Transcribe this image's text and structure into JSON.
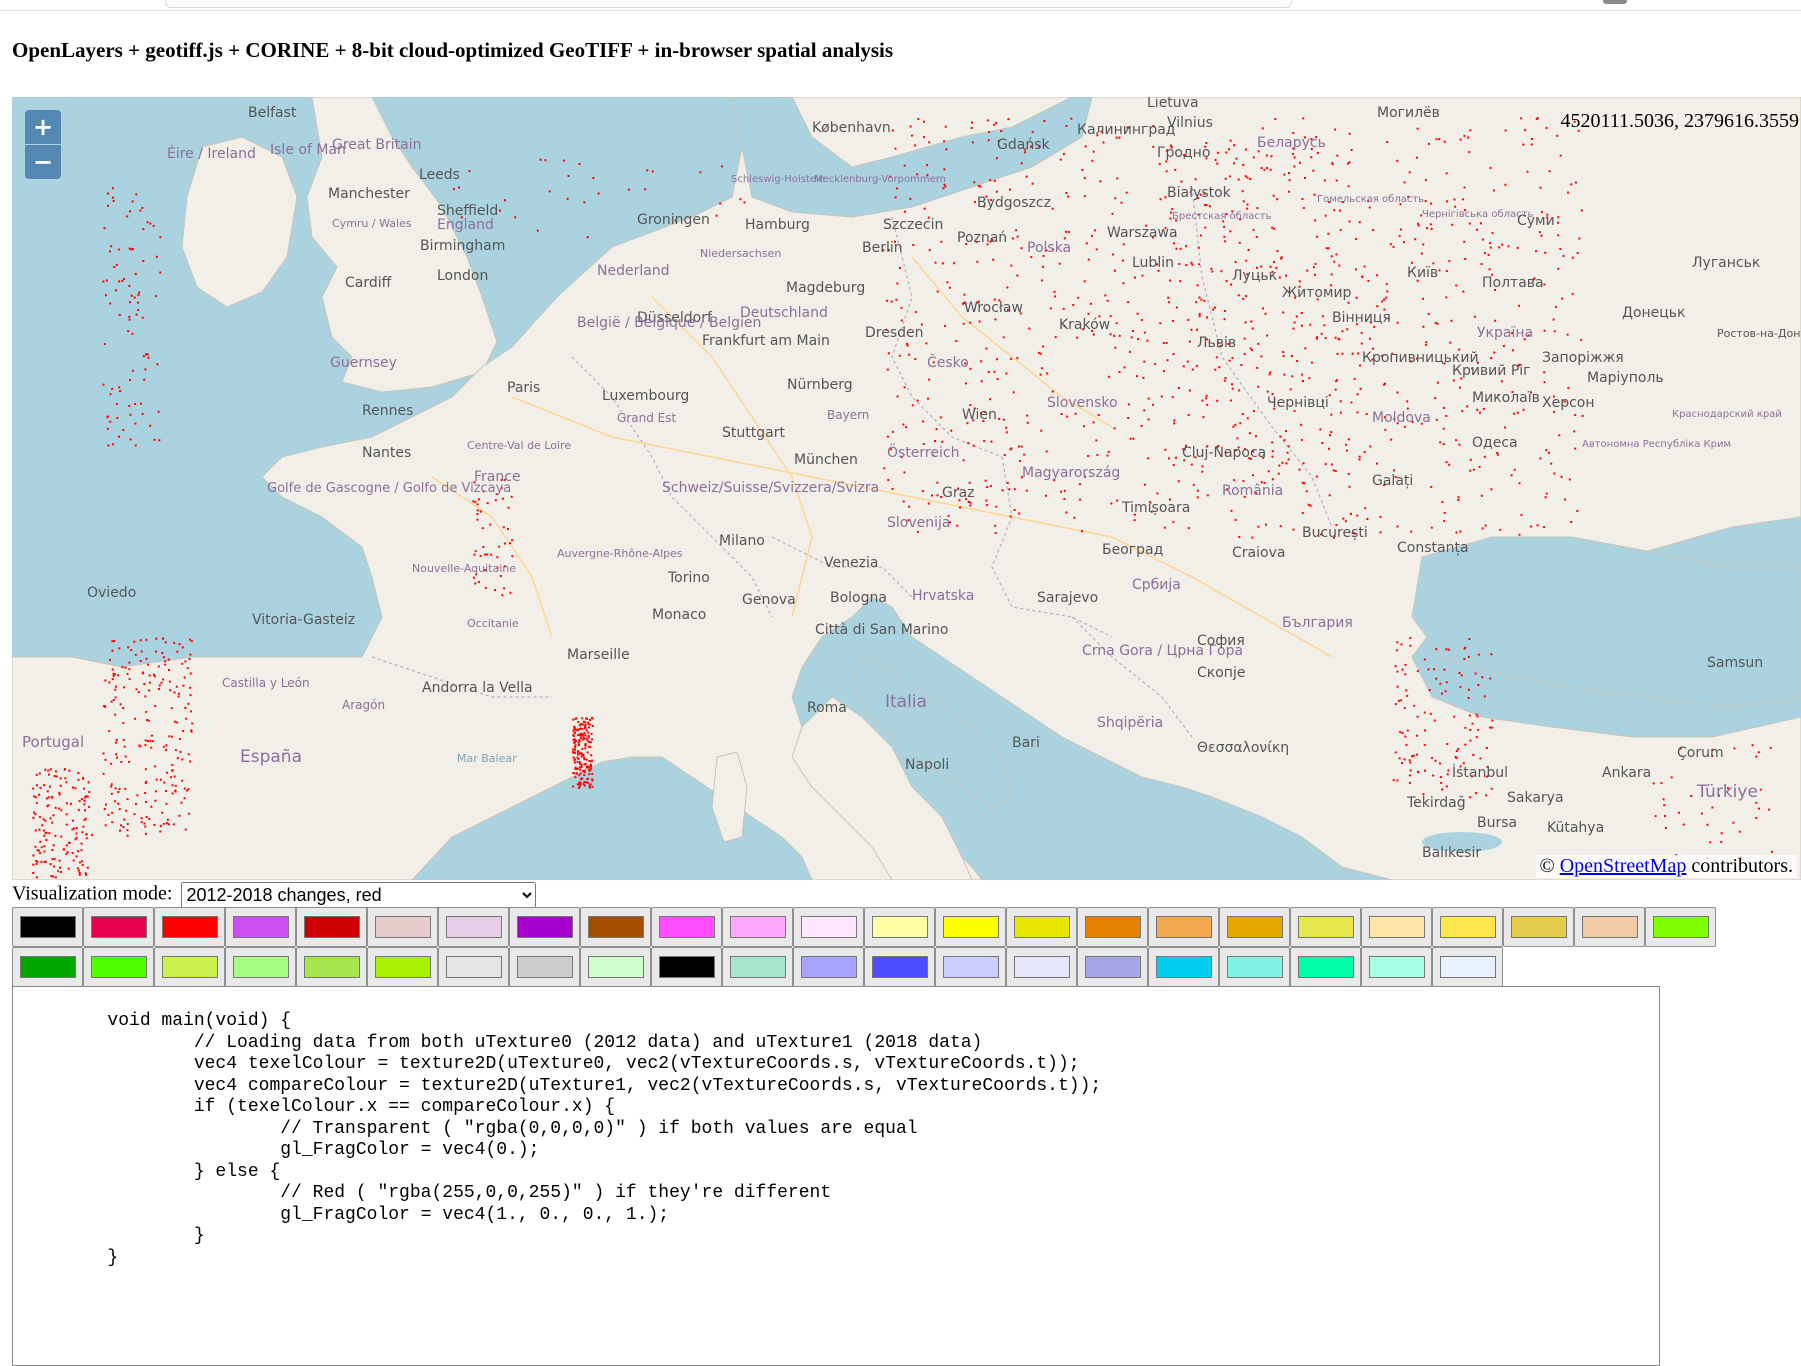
{
  "page": {
    "title": "OpenLayers + geotiff.js + CORINE + 8-bit cloud-optimized GeoTIFF + in-browser spatial analysis"
  },
  "map": {
    "zoom_in_label": "+",
    "zoom_out_label": "−",
    "mouse_position": "4520111.5036, 2379616.3559",
    "attribution": {
      "prefix": "© ",
      "link_text": "OpenStreetMap",
      "suffix": " contributors."
    },
    "labels": {
      "belfast": "Belfast",
      "isle_of_man": "Isle of Man",
      "great_britain": "Great Britain",
      "eire": "Éire / Ireland",
      "leeds": "Leeds",
      "manchester": "Manchester",
      "sheffield": "Sheffield",
      "england": "England",
      "cymru": "Cymru / Wales",
      "birmingham": "Birmingham",
      "cardiff": "Cardiff",
      "london": "London",
      "guernsey": "Guernsey",
      "kobenhavn": "København",
      "schleswig": "Schleswig-Holstein",
      "mecklenburg": "Mecklenburg-Vorpommern",
      "hamburg": "Hamburg",
      "groningen": "Groningen",
      "niedersachsen": "Niedersachsen",
      "nederland": "Nederland",
      "berlin": "Berlin",
      "szczecin": "Szczecin",
      "magdeburg": "Magdeburg",
      "dusseldorf": "Düsseldorf",
      "deutschland": "Deutschland",
      "belgie": "België / Belgique / Belgien",
      "frankfurt": "Frankfurt am Main",
      "dresden": "Dresden",
      "luxembourg": "Luxembourg",
      "paris": "Paris",
      "rennes": "Rennes",
      "nantes": "Nantes",
      "centre": "Centre-Val de Loire",
      "france": "France",
      "grand_est": "Grand Est",
      "stuttgart": "Stuttgart",
      "nurnberg": "Nürnberg",
      "bayern": "Bayern",
      "munchen": "München",
      "schweiz": "Schweiz/Suisse/Svizzera/Svizra",
      "golfe": "Golfe de Gascogne / Golfo de Vizcaya",
      "nouvelle_aquitaine": "Nouvelle-Aquitaine",
      "auvergne": "Auvergne-Rhône-Alpes",
      "occitanie": "Occitanie",
      "oviedo": "Oviedo",
      "vitoria": "Vitoria-Gasteiz",
      "castilla": "Castilla y León",
      "aragon": "Aragón",
      "andorra": "Andorra la Vella",
      "espana": "España",
      "portugal": "Portugal",
      "marseille": "Marseille",
      "monaco": "Monaco",
      "torino": "Torino",
      "milano": "Milano",
      "genova": "Genova",
      "bologna": "Bologna",
      "venezia": "Venezia",
      "san_marino": "Città di San Marino",
      "roma": "Roma",
      "italia": "Italia",
      "bari": "Bari",
      "napoli": "Napoli",
      "mar_balear": "Mar Balear",
      "gdansk": "Gdańsk",
      "bydgoszcz": "Bydgoszcz",
      "poznan": "Poznań",
      "polska": "Polska",
      "warszawa": "Warszawa",
      "lublin": "Lublin",
      "wroclaw": "Wrocław",
      "krakow": "Kraków",
      "cesko": "Česko",
      "wien": "Wien",
      "osterreich": "Österreich",
      "graz": "Graz",
      "slovenija": "Slovenija",
      "hrvatska": "Hrvatska",
      "slovensko": "Slovensko",
      "magyarorszag": "Magyarország",
      "sarajevo": "Sarajevo",
      "beograd": "Београд",
      "srbija": "Србија",
      "crna_gora": "Crna Gora / Црна Гора",
      "shqiperia": "Shqipëria",
      "greece": "Θεσσαλονίκη",
      "skopje": "Скопје",
      "sofia": "София",
      "bulgaria": "България",
      "timisoara": "Timișoara",
      "cluj": "Cluj-Napoca",
      "romania": "România",
      "craiova": "Craiova",
      "bucuresti": "București",
      "constanta": "Constanța",
      "galati": "Galați",
      "moldova": "Moldova",
      "bialystok": "Białystok",
      "lietuva": "Lietuva",
      "vilnius": "Vilnius",
      "kaliningrad": "Калининград",
      "grodno": "Гродно",
      "belarus": "Беларусь",
      "mogilev": "Могилёв",
      "brest_obl": "Брестская область",
      "gomel_obl": "Гомельская область",
      "chernihiv": "Чернігівська область",
      "sumy": "Суми",
      "kyiv": "Київ",
      "lutsk": "Луцьк",
      "zhytomyr": "Житомир",
      "lviv": "Львів",
      "vinnytsia": "Вінниця",
      "ukraina": "Україна",
      "kropyvnytskyi": "Кропивницький",
      "kryvyi_rih": "Кривий Ріг",
      "zaporizhzhia": "Запоріжжя",
      "poltava": "Полтава",
      "mariupol": "Маріуполь",
      "donetsk": "Донецьк",
      "luhansk": "Луганськ",
      "chernivtsi": "Чернівці",
      "mykolaiv": "Миколаїв",
      "kherson": "Херсон",
      "odesa": "Одеса",
      "krym": "Автономна Республіка Крим",
      "krasnodar": "Краснодарский край",
      "rostov": "Ростов-на-Дону",
      "istanbul": "İstanbul",
      "tekirdag": "Tekirdağ",
      "bursa": "Bursa",
      "balikesir": "Balıkesir",
      "sakarya": "Sakarya",
      "kutahya": "Kütahya",
      "ankara": "Ankara",
      "corum": "Çorum",
      "samsun": "Samsun",
      "turkiye": "Türkiye"
    }
  },
  "controls": {
    "viz_label": "Visualization mode:",
    "viz_selected": "2012-2018 changes, red"
  },
  "swatches": {
    "row1": [
      "#000000",
      "#e6004d",
      "#ff0000",
      "#cc4df2",
      "#cc0000",
      "#e6cccc",
      "#e6cce6",
      "#a600cc",
      "#a64d00",
      "#ff4dff",
      "#ffa6ff",
      "#ffe6ff",
      "#ffffa8",
      "#ffff00",
      "#e6e600",
      "#e68000",
      "#f2a64d",
      "#e6a600",
      "#e6e64d",
      "#ffe6a6",
      "#ffe64d",
      "#e6cc4d",
      "#f2cca6",
      "#80ff00"
    ],
    "row2": [
      "#00a600",
      "#4dff00",
      "#ccf24d",
      "#a6ff80",
      "#a6e64d",
      "#a6f200",
      "#e6e6e6",
      "#cccccc",
      "#ccffcc",
      "#000000",
      "#a6e6cc",
      "#a6a6ff",
      "#4d4dff",
      "#ccccff",
      "#e6e6ff",
      "#a6a6e6",
      "#00ccf2",
      "#80f2e6",
      "#00ffa6",
      "#a6ffe6",
      "#e6f2ff"
    ]
  },
  "shader": {
    "code": "\tvoid main(void) {\n\t\t// Loading data from both uTexture0 (2012 data) and uTexture1 (2018 data)\n\t\tvec4 texelColour = texture2D(uTexture0, vec2(vTextureCoords.s, vTextureCoords.t));\n\t\tvec4 compareColour = texture2D(uTexture1, vec2(vTextureCoords.s, vTextureCoords.t));\n\t\tif (texelColour.x == compareColour.x) {\n\t\t\t// Transparent ( \"rgba(0,0,0,0)\" ) if both values are equal\n\t\t\tgl_FragColor = vec4(0.);\n\t\t} else {\n\t\t\t// Red ( \"rgba(255,0,0,255)\" ) if they're different\n\t\t\tgl_FragColor = vec4(1., 0., 0., 1.);\n\t\t}\n\t}"
  }
}
